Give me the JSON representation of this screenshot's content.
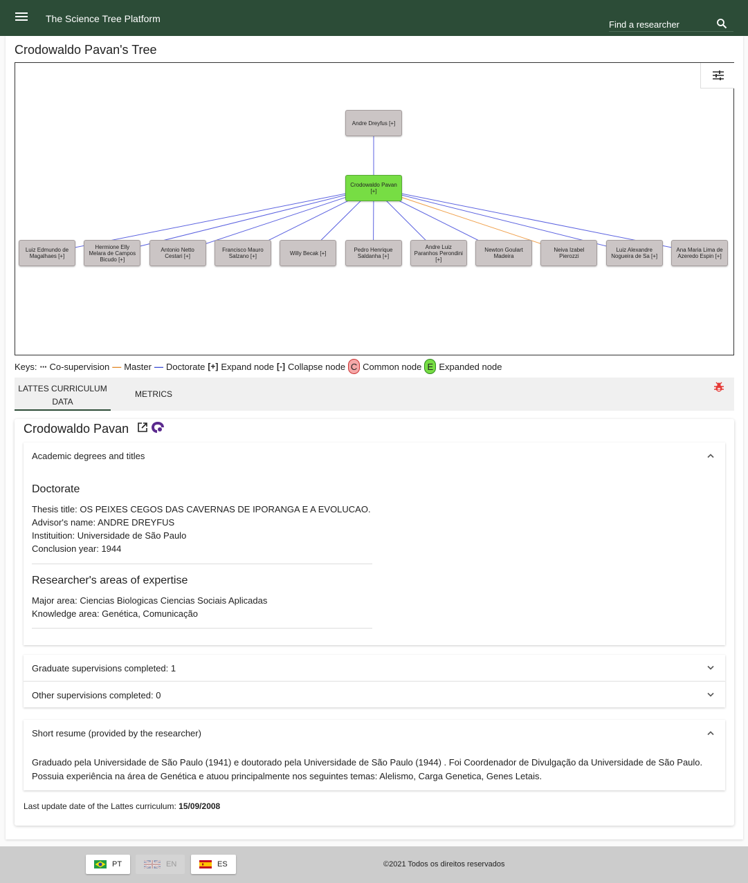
{
  "header": {
    "app_title": "The Science Tree Platform",
    "search_placeholder": "Find a researcher"
  },
  "page": {
    "title": "Crodowaldo Pavan's Tree"
  },
  "tree": {
    "ancestor": {
      "label": "Andre Dreyfus [+]"
    },
    "center": {
      "label": "Crodowaldo Pavan [+]"
    },
    "children": [
      {
        "label": "Luiz Edmundo de Magalhaes [+]",
        "relation": "doctorate"
      },
      {
        "label": "Hermione Elly Melara de Campos Bicudo [+]",
        "relation": "doctorate"
      },
      {
        "label": "Antonio Netto Cestari [+]",
        "relation": "doctorate"
      },
      {
        "label": "Francisco Mauro Salzano [+]",
        "relation": "doctorate"
      },
      {
        "label": "Willy Becak [+]",
        "relation": "doctorate"
      },
      {
        "label": "Pedro Henrique Saldanha [+]",
        "relation": "doctorate"
      },
      {
        "label": "Andre Luiz Paranhos Perondini [+]",
        "relation": "doctorate"
      },
      {
        "label": "Newton Goulart Madeira",
        "relation": "doctorate"
      },
      {
        "label": "Neiva Izabel Pierozzi",
        "relation": "master"
      },
      {
        "label": "Luiz Alexandre Nogueira de Sa [+]",
        "relation": "doctorate"
      },
      {
        "label": "Ana Maria Lima de Azeredo Espin [+]",
        "relation": "doctorate"
      }
    ],
    "colors": {
      "doctorate": "#5b62e0",
      "master": "#f0a04b",
      "node": "#cbc5c5",
      "expanded": "#77dd44"
    }
  },
  "keys": {
    "prefix": "Keys:",
    "co_supervision": "Co-supervision",
    "master": "Master",
    "doctorate": "Doctorate",
    "expand_symbol": "[+]",
    "expand": "Expand node",
    "collapse_symbol": "[-]",
    "collapse": "Collapse node",
    "common_badge": "C",
    "common": "Common node",
    "expanded_badge": "E",
    "expanded": "Expanded node"
  },
  "tabs": [
    {
      "label": "LATTES CURRICULUM DATA",
      "active": true
    },
    {
      "label": "METRICS",
      "active": false
    }
  ],
  "profile": {
    "name": "Crodowaldo Pavan",
    "degrees_panel": {
      "title": "Academic degrees and titles",
      "doctorate_heading": "Doctorate",
      "thesis": "Thesis title: OS PEIXES CEGOS DAS CAVERNAS DE IPORANGA E A EVOLUCAO.",
      "advisor": "Advisor's name: ANDRE DREYFUS",
      "institution": "Instituition: Universidade de São Paulo",
      "conclusion": "Conclusion year: 1944",
      "expertise_heading": "Researcher's areas of expertise",
      "major_area": "Major area: Ciencias Biologicas Ciencias Sociais Aplicadas",
      "knowledge_area": "Knowledge area: Genética, Comunicação"
    },
    "graduate_panel": {
      "title": "Graduate supervisions completed: 1"
    },
    "other_panel": {
      "title": "Other supervisions completed: 0"
    },
    "resume_panel": {
      "title": "Short resume (provided by the researcher)",
      "text": "Graduado pela Universidade de São Paulo (1941) e doutorado pela Universidade de São Paulo (1944) . Foi Coordenador de Divulgação da Universidade de São Paulo. Possuia experiência na área de Genética e atuou principalmente nos seguintes temas: Alelismo, Carga Genetica, Genes Letais."
    },
    "last_update_label": "Last update date of the Lattes curriculum:",
    "last_update_date": "15/09/2008"
  },
  "footer": {
    "languages": [
      {
        "code": "PT",
        "flag": "brazil-flag",
        "enabled": true
      },
      {
        "code": "EN",
        "flag": "uk-flag",
        "enabled": false
      },
      {
        "code": "ES",
        "flag": "spain-flag",
        "enabled": true
      }
    ],
    "copyright": "©2021 Todos os direitos reservados"
  }
}
